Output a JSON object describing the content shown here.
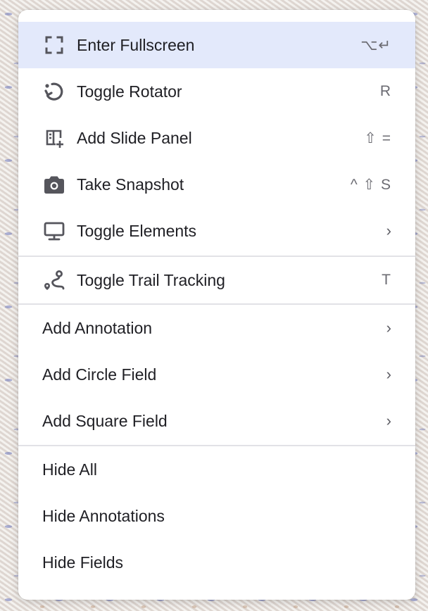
{
  "menu": {
    "items": [
      {
        "label": "Enter Fullscreen",
        "icon": "fullscreen-icon",
        "shortcut": "⌥↵",
        "active": true
      },
      {
        "label": "Toggle Rotator",
        "icon": "rotate-icon",
        "shortcut": "R"
      },
      {
        "label": "Add Slide Panel",
        "icon": "add-panel-icon",
        "shortcut": "⇧ ="
      },
      {
        "label": "Take Snapshot",
        "icon": "camera-icon",
        "shortcut": "^ ⇧ S"
      },
      {
        "label": "Toggle Elements",
        "icon": "monitor-icon",
        "submenu_indicator": "›"
      },
      {
        "label": "Toggle Trail Tracking",
        "icon": "route-icon",
        "shortcut": "T"
      },
      {
        "label": "Add Annotation",
        "submenu_indicator": "›"
      },
      {
        "label": "Add Circle Field",
        "submenu_indicator": "›"
      },
      {
        "label": "Add Square Field",
        "submenu_indicator": "›"
      },
      {
        "label": "Hide All"
      },
      {
        "label": "Hide Annotations"
      },
      {
        "label": "Hide Fields"
      }
    ]
  },
  "colors": {
    "highlight": "#e3e9fb",
    "icon": "#55555c",
    "text": "#1f1f24",
    "shortcut": "#6b6b72",
    "separator": "#e2e2e6"
  }
}
